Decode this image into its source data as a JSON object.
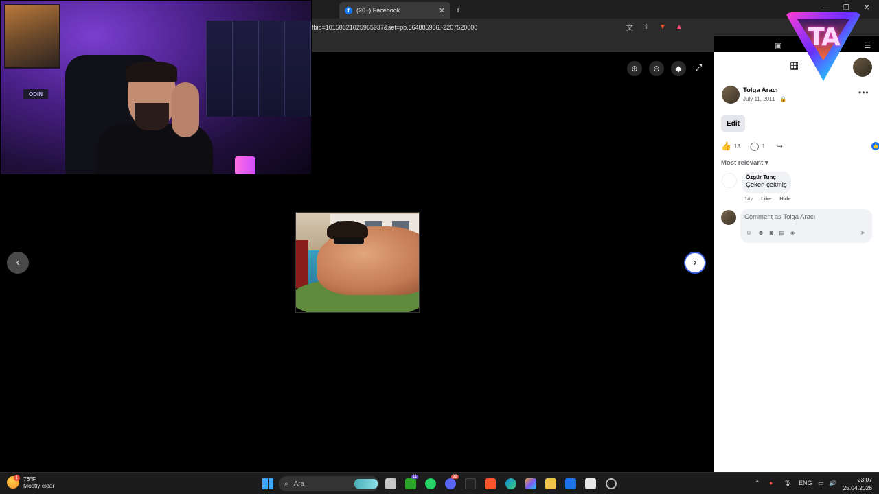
{
  "browser": {
    "tab_title": "(20+) Facebook",
    "url": "fbid=10150321025965937&set=pb.564885936.-2207520000"
  },
  "webcam": {
    "sign_text": "ODIN"
  },
  "post": {
    "author": "Tolga Aracı",
    "date": "July 11, 2011 · ",
    "edit_label": "Edit",
    "like_count": "13",
    "comment_count": "1",
    "sort_label": "Most relevant",
    "comments": [
      {
        "name": "Özgür Tunç",
        "text": "Çeken çekmiş",
        "age": "14y",
        "like_label": "Like",
        "hide_label": "Hide"
      }
    ],
    "comment_placeholder": "Comment as Tolga Aracı"
  },
  "logo": {
    "text": "TA"
  },
  "taskbar": {
    "weather_temp": "76°F",
    "weather_condition": "Mostly clear",
    "weather_badge": "1",
    "search_label": "Ara",
    "language": "ENG",
    "time": "23:07",
    "date": "25.04.2026",
    "badge_xbox": "11",
    "badge_discord": "99"
  },
  "colors": {
    "facebook_blue": "#1877f2",
    "viewer_bg": "#000000",
    "panel_bg": "#ffffff",
    "taskbar_bg": "#1c1c1c"
  }
}
